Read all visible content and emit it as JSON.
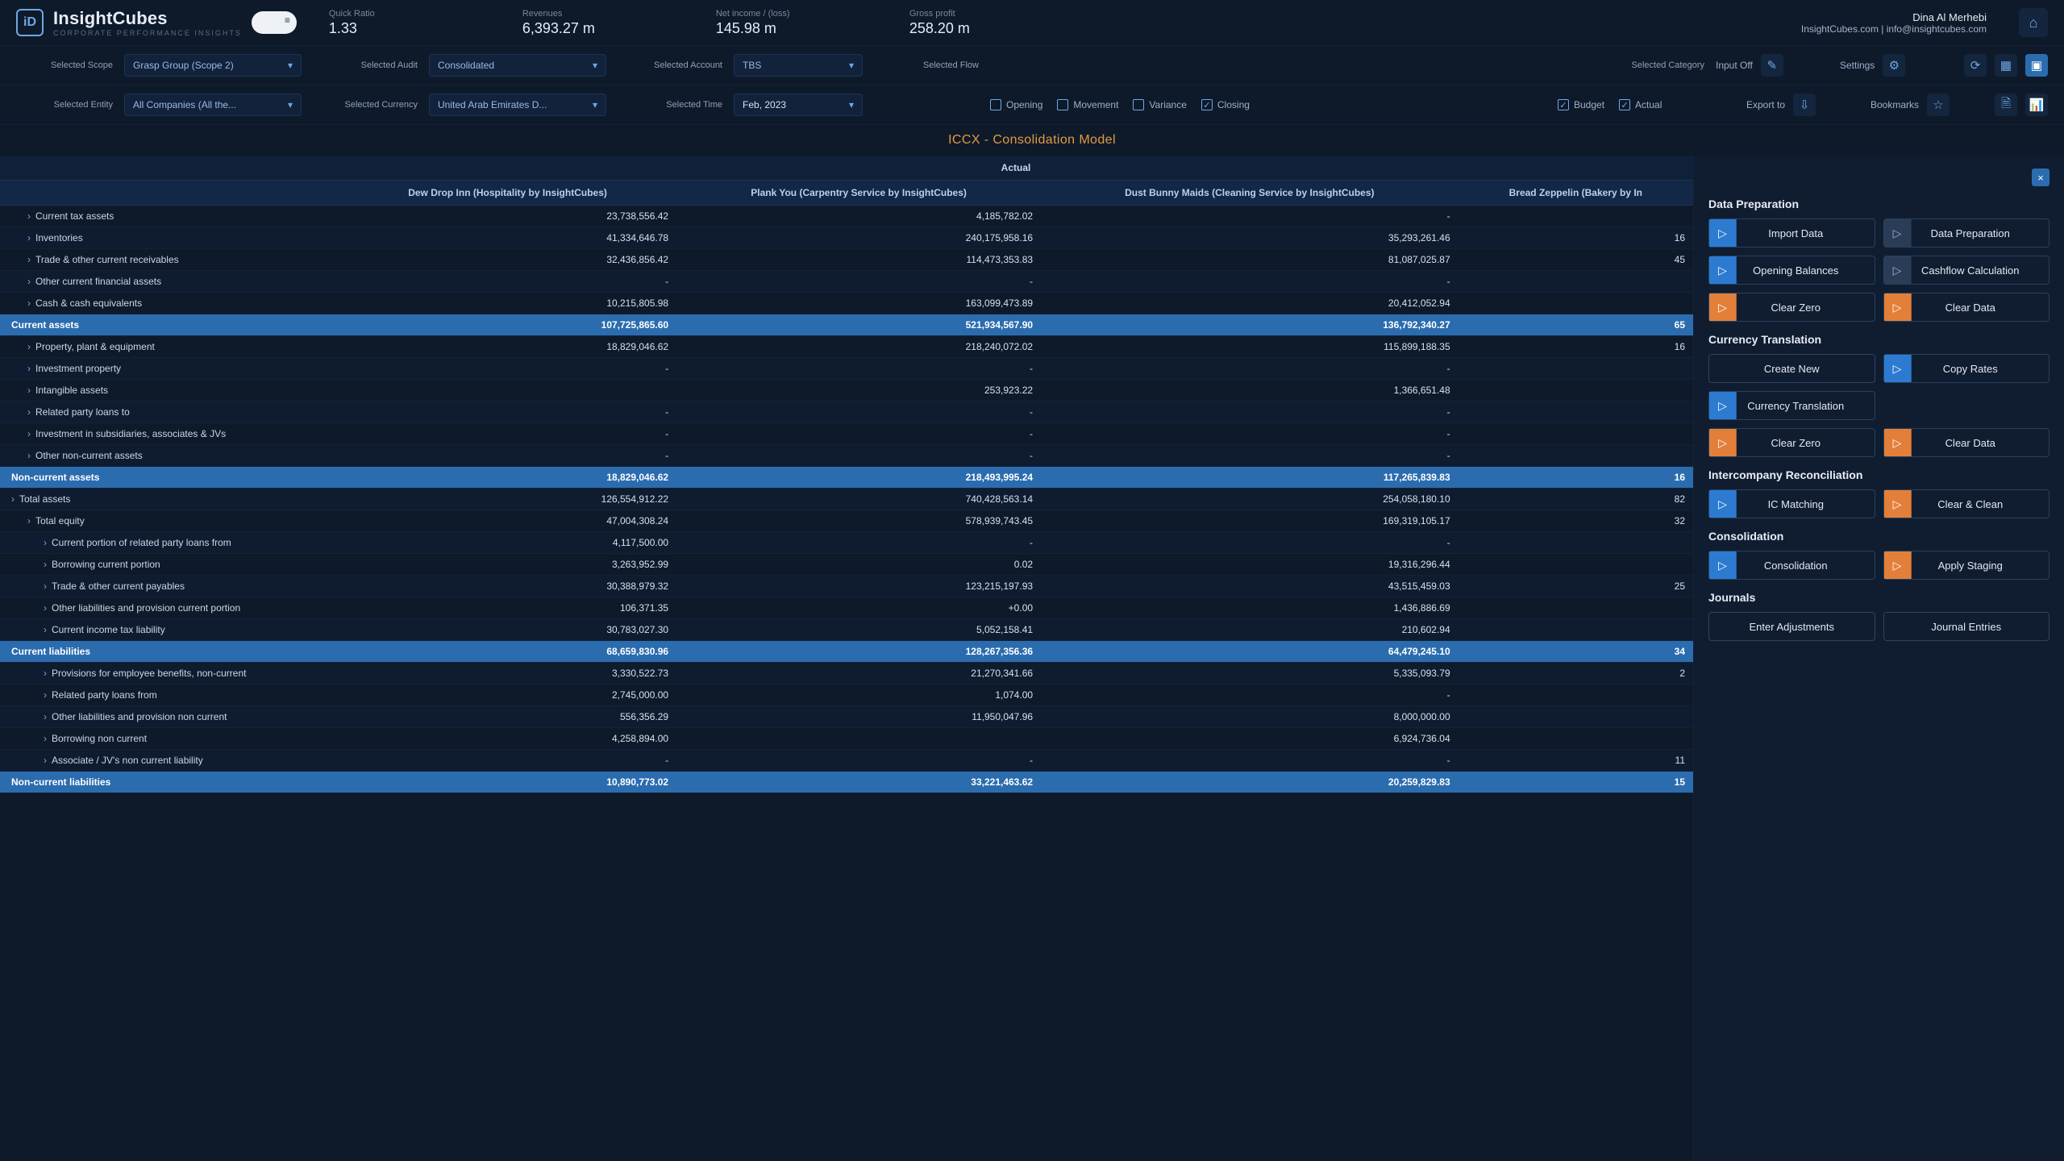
{
  "brand": {
    "name": "InsightCubes",
    "tagline": "CORPORATE PERFORMANCE INSIGHTS"
  },
  "user": {
    "name": "Dina Al Merhebi",
    "contact": "InsightCubes.com | info@insightcubes.com"
  },
  "kpis": [
    {
      "label": "Quick Ratio",
      "value": "1.33"
    },
    {
      "label": "Revenues",
      "value": "6,393.27 m"
    },
    {
      "label": "Net income / (loss)",
      "value": "145.98 m"
    },
    {
      "label": "Gross profit",
      "value": "258.20 m"
    }
  ],
  "filters": {
    "scope": {
      "label": "Selected Scope",
      "value": "Grasp Group (Scope 2)"
    },
    "audit": {
      "label": "Selected Audit",
      "value": "Consolidated"
    },
    "account": {
      "label": "Selected Account",
      "value": "TBS"
    },
    "flow": {
      "label": "Selected Flow"
    },
    "category": {
      "label": "Selected Category"
    },
    "entity": {
      "label": "Selected Entity",
      "value": "All Companies (All the..."
    },
    "currency": {
      "label": "Selected Currency",
      "value": "United Arab Emirates D..."
    },
    "time": {
      "label": "Selected Time",
      "value": "Feb, 2023"
    },
    "flow_checks": {
      "opening": {
        "label": "Opening",
        "checked": false
      },
      "movement": {
        "label": "Movement",
        "checked": false
      },
      "variance": {
        "label": "Variance",
        "checked": false
      },
      "closing": {
        "label": "Closing",
        "checked": true
      }
    },
    "cat_checks": {
      "budget": {
        "label": "Budget",
        "checked": true
      },
      "actual": {
        "label": "Actual",
        "checked": true
      }
    },
    "right": {
      "input": "Input Off",
      "settings": "Settings",
      "export": "Export to",
      "bookmarks": "Bookmarks"
    }
  },
  "report_title": "ICCX - Consolidation Model",
  "table": {
    "group_header": "Actual",
    "columns": [
      "Dew Drop Inn (Hospitality by InsightCubes)",
      "Plank You (Carpentry Service by InsightCubes)",
      "Dust Bunny Maids (Cleaning Service by InsightCubes)",
      "Bread Zeppelin (Bakery by In"
    ],
    "rows": [
      {
        "lvl": 2,
        "caret": true,
        "account": "Current tax assets",
        "v": [
          "23,738,556.42",
          "4,185,782.02",
          "-",
          ""
        ]
      },
      {
        "lvl": 2,
        "caret": true,
        "account": "Inventories",
        "v": [
          "41,334,646.78",
          "240,175,958.16",
          "35,293,261.46",
          "16"
        ]
      },
      {
        "lvl": 2,
        "caret": true,
        "account": "Trade & other current receivables",
        "v": [
          "32,436,856.42",
          "114,473,353.83",
          "81,087,025.87",
          "45"
        ]
      },
      {
        "lvl": 2,
        "caret": true,
        "account": "Other current financial assets",
        "v": [
          "-",
          "-",
          "-",
          ""
        ]
      },
      {
        "lvl": 2,
        "caret": true,
        "account": "Cash & cash equivalents",
        "v": [
          "10,215,805.98",
          "163,099,473.89",
          "20,412,052.94",
          ""
        ]
      },
      {
        "lvl": 1,
        "subtotal": true,
        "account": "Current assets",
        "v": [
          "107,725,865.60",
          "521,934,567.90",
          "136,792,340.27",
          "65"
        ]
      },
      {
        "lvl": 2,
        "caret": true,
        "account": "Property, plant & equipment",
        "v": [
          "18,829,046.62",
          "218,240,072.02",
          "115,899,188.35",
          "16"
        ]
      },
      {
        "lvl": 2,
        "caret": true,
        "account": "Investment property",
        "v": [
          "-",
          "-",
          "-",
          ""
        ]
      },
      {
        "lvl": 2,
        "caret": true,
        "account": "Intangible assets",
        "v": [
          "",
          "253,923.22",
          "1,366,651.48",
          ""
        ]
      },
      {
        "lvl": 2,
        "caret": true,
        "account": "Related party loans to",
        "v": [
          "-",
          "-",
          "-",
          ""
        ]
      },
      {
        "lvl": 2,
        "caret": true,
        "account": "Investment in subsidiaries, associates & JVs",
        "v": [
          "-",
          "-",
          "-",
          ""
        ]
      },
      {
        "lvl": 2,
        "caret": true,
        "account": "Other non-current assets",
        "v": [
          "-",
          "-",
          "-",
          ""
        ]
      },
      {
        "lvl": 1,
        "subtotal": true,
        "account": "Non-current assets",
        "v": [
          "18,829,046.62",
          "218,493,995.24",
          "117,265,839.83",
          "16"
        ]
      },
      {
        "lvl": 1,
        "caret": true,
        "account": "Total assets",
        "v": [
          "126,554,912.22",
          "740,428,563.14",
          "254,058,180.10",
          "82"
        ]
      },
      {
        "lvl": 2,
        "caret": true,
        "account": "Total equity",
        "v": [
          "47,004,308.24",
          "578,939,743.45",
          "169,319,105.17",
          "32"
        ]
      },
      {
        "lvl": 3,
        "caret": true,
        "account": "Current portion of related party loans from",
        "v": [
          "4,117,500.00",
          "-",
          "-",
          ""
        ]
      },
      {
        "lvl": 3,
        "caret": true,
        "account": "Borrowing current portion",
        "v": [
          "3,263,952.99",
          "0.02",
          "19,316,296.44",
          ""
        ]
      },
      {
        "lvl": 3,
        "caret": true,
        "account": "Trade & other current payables",
        "v": [
          "30,388,979.32",
          "123,215,197.93",
          "43,515,459.03",
          "25"
        ]
      },
      {
        "lvl": 3,
        "caret": true,
        "account": "Other liabilities and provision current portion",
        "v": [
          "106,371.35",
          "+0.00",
          "1,436,886.69",
          ""
        ]
      },
      {
        "lvl": 3,
        "caret": true,
        "account": "Current income tax liability",
        "v": [
          "30,783,027.30",
          "5,052,158.41",
          "210,602.94",
          ""
        ]
      },
      {
        "lvl": 1,
        "subtotal": true,
        "account": "Current liabilities",
        "v": [
          "68,659,830.96",
          "128,267,356.36",
          "64,479,245.10",
          "34"
        ]
      },
      {
        "lvl": 3,
        "caret": true,
        "account": "Provisions for employee benefits, non-current",
        "v": [
          "3,330,522.73",
          "21,270,341.66",
          "5,335,093.79",
          "2"
        ]
      },
      {
        "lvl": 3,
        "caret": true,
        "account": "Related party loans from",
        "v": [
          "2,745,000.00",
          "1,074.00",
          "-",
          ""
        ]
      },
      {
        "lvl": 3,
        "caret": true,
        "account": "Other liabilities and provision non current",
        "v": [
          "556,356.29",
          "11,950,047.96",
          "8,000,000.00",
          ""
        ]
      },
      {
        "lvl": 3,
        "caret": true,
        "account": "Borrowing non current",
        "v": [
          "4,258,894.00",
          "",
          "6,924,736.04",
          ""
        ]
      },
      {
        "lvl": 3,
        "caret": true,
        "account": "Associate / JV's non current liability",
        "v": [
          "-",
          "-",
          "-",
          "11"
        ]
      },
      {
        "lvl": 1,
        "subtotal": true,
        "account": "Non-current liabilities",
        "v": [
          "10,890,773.02",
          "33,221,463.62",
          "20,259,829.83",
          "15"
        ]
      }
    ]
  },
  "sidepanel": {
    "sections": [
      {
        "title": "Data Preparation",
        "buttons": [
          {
            "icon": "blue",
            "label": "Import Data"
          },
          {
            "icon": "grey",
            "label": "Data Preparation"
          },
          {
            "icon": "blue",
            "label": "Opening Balances"
          },
          {
            "icon": "grey",
            "label": "Cashflow Calculation"
          },
          {
            "icon": "orange",
            "label": "Clear Zero"
          },
          {
            "icon": "orange",
            "label": "Clear Data"
          }
        ]
      },
      {
        "title": "Currency Translation",
        "buttons": [
          {
            "icon": "none",
            "label": "Create New"
          },
          {
            "icon": "blue",
            "label": "Copy Rates"
          },
          {
            "icon": "blue",
            "label": "Currency Translation"
          },
          {
            "icon": "none",
            "label": "",
            "hidden": true
          },
          {
            "icon": "orange",
            "label": "Clear Zero"
          },
          {
            "icon": "orange",
            "label": "Clear Data"
          }
        ]
      },
      {
        "title": "Intercompany Reconciliation",
        "buttons": [
          {
            "icon": "blue",
            "label": "IC Matching"
          },
          {
            "icon": "orange",
            "label": "Clear & Clean"
          }
        ]
      },
      {
        "title": "Consolidation",
        "buttons": [
          {
            "icon": "blue",
            "label": "Consolidation"
          },
          {
            "icon": "orange",
            "label": "Apply Staging"
          }
        ]
      },
      {
        "title": "Journals",
        "buttons": [
          {
            "icon": "none",
            "label": "Enter Adjustments"
          },
          {
            "icon": "none",
            "label": "Journal Entries"
          }
        ]
      }
    ]
  }
}
